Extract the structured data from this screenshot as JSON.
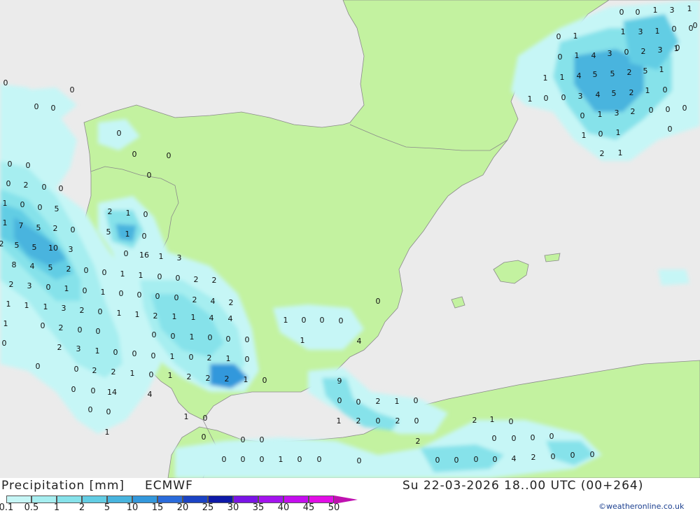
{
  "title": "Precipitation [mm]",
  "model": "ECMWF",
  "valid_time": "Su 22-03-2026 18..00 UTC (00+264)",
  "credit": "©weatheronline.co.uk",
  "colors": {
    "sea": "#ebebeb",
    "land": "#c3f2a0",
    "border": "#8a8a8a"
  },
  "legend": {
    "ticks": [
      "0.1",
      "0.5",
      "1",
      "2",
      "5",
      "10",
      "15",
      "20",
      "25",
      "30",
      "35",
      "40",
      "45",
      "50"
    ],
    "colors": [
      "#c6f6f6",
      "#a6eef0",
      "#86e2ea",
      "#62cde4",
      "#48b4de",
      "#3398dc",
      "#2a6bdb",
      "#1b43c4",
      "#0e19a8",
      "#7a14e6",
      "#a413ee",
      "#c40dee",
      "#e20ee6",
      "#bf12b0"
    ]
  },
  "values": [
    "0",
    "0",
    "1",
    "3",
    "1",
    "1",
    "3",
    "1",
    "0",
    "0",
    "0",
    "1",
    "1",
    "4",
    "3",
    "0",
    "2",
    "3",
    "1",
    "0",
    "1",
    "1",
    "4",
    "5",
    "5",
    "2",
    "5",
    "1",
    "1",
    "0",
    "0",
    "3",
    "4",
    "5",
    "2",
    "1",
    "0",
    "0",
    "1",
    "3",
    "2",
    "0",
    "0",
    "0",
    "1",
    "0",
    "1",
    "2",
    "1",
    "0",
    "0",
    "0",
    "0",
    "0",
    "0",
    "0",
    "0",
    "0",
    "0",
    "0",
    "0",
    "0",
    "0",
    "2",
    "1",
    "0",
    "0",
    "5",
    "2",
    "1",
    "0",
    "1",
    "7",
    "5",
    "2",
    "0",
    "5",
    "1",
    "0",
    "2",
    "5",
    "5",
    "10",
    "3",
    "0",
    "16",
    "1",
    "3",
    "8",
    "4",
    "5",
    "2",
    "0",
    "0",
    "1",
    "1",
    "0",
    "0",
    "2",
    "2",
    "2",
    "3",
    "0",
    "1",
    "0",
    "1",
    "0",
    "0",
    "0",
    "0",
    "2",
    "4",
    "2",
    "1",
    "1",
    "1",
    "3",
    "2",
    "0",
    "1",
    "1",
    "2",
    "1",
    "1",
    "4",
    "4",
    "1",
    "0",
    "2",
    "0",
    "0",
    "0",
    "0",
    "1",
    "0",
    "0",
    "0",
    "0",
    "2",
    "3",
    "1",
    "0",
    "0",
    "0",
    "1",
    "0",
    "2",
    "1",
    "0",
    "0",
    "0",
    "2",
    "2",
    "1",
    "0",
    "1",
    "2",
    "2",
    "2",
    "1",
    "0",
    "0",
    "0",
    "14",
    "4",
    "0",
    "0",
    "1",
    "1",
    "0",
    "9",
    "0",
    "0",
    "2",
    "1",
    "0",
    "1",
    "2",
    "0",
    "2",
    "0",
    "2",
    "2",
    "1",
    "0",
    "0",
    "0",
    "0",
    "0",
    "0",
    "0",
    "0",
    "0",
    "0",
    "0",
    "1",
    "0",
    "0",
    "0",
    "0",
    "0",
    "0",
    "0",
    "4",
    "2",
    "0",
    "0",
    "0",
    "1",
    "0",
    "0",
    "0",
    "1",
    "4",
    "0",
    "0",
    "0"
  ]
}
